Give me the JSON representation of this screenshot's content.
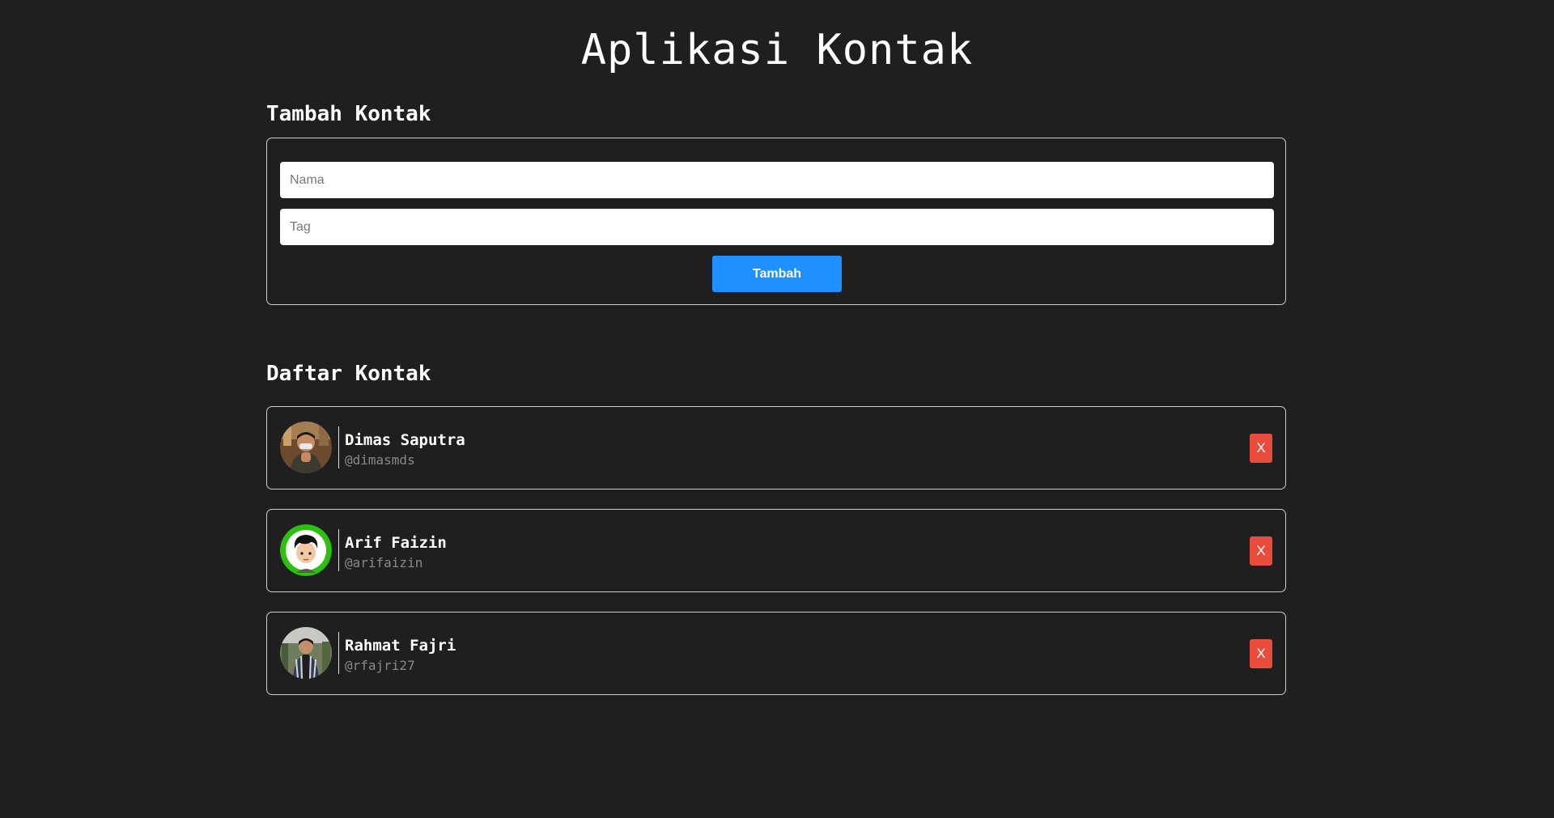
{
  "app": {
    "title": "Aplikasi Kontak"
  },
  "add_section": {
    "title": "Tambah Kontak",
    "name_placeholder": "Nama",
    "name_value": "",
    "tag_placeholder": "Tag",
    "tag_value": "",
    "submit_label": "Tambah"
  },
  "list_section": {
    "title": "Daftar Kontak",
    "delete_label": "X",
    "contacts": [
      {
        "name": "Dimas Saputra",
        "tag": "@dimasmds",
        "avatar": "photo-avatar-icon"
      },
      {
        "name": "Arif Faizin",
        "tag": "@arifaizin",
        "avatar": "cartoon-avatar-icon"
      },
      {
        "name": "Rahmat Fajri",
        "tag": "@rfajri27",
        "avatar": "photo-avatar-icon"
      }
    ]
  },
  "colors": {
    "background": "#1f1f1f",
    "primary_button": "#1e90ff",
    "delete_button": "#e74c3c",
    "border": "#cfcfcf",
    "tag_text": "#8a8a8a"
  }
}
